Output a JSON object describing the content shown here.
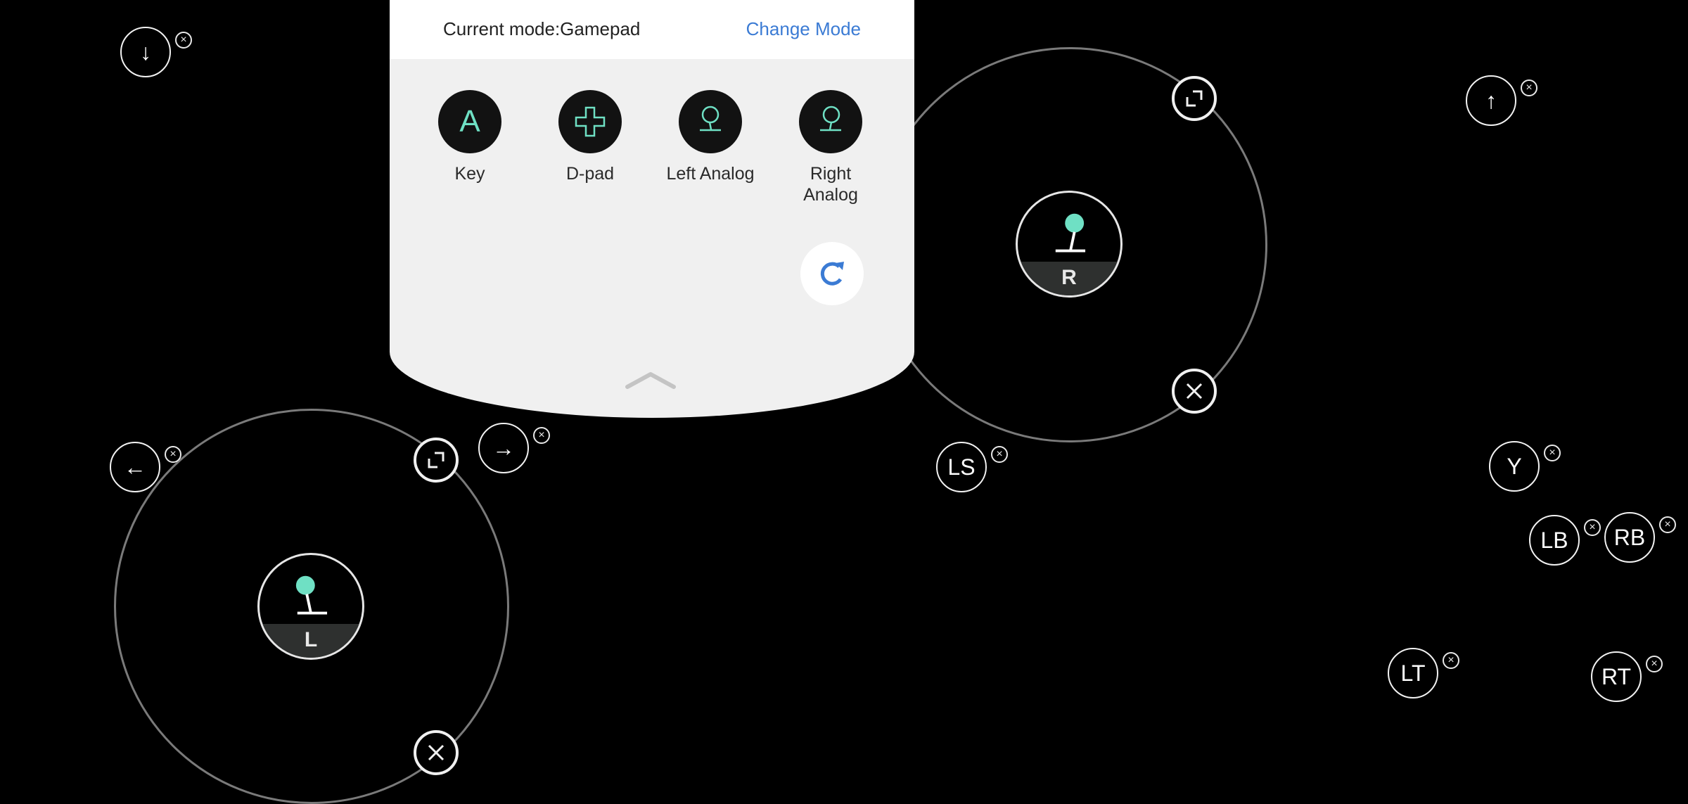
{
  "panel": {
    "current_mode_label": "Current mode:Gamepad",
    "change_mode_label": "Change Mode",
    "tools": [
      {
        "label": "Key",
        "icon": "key-a-icon",
        "glyph": "A"
      },
      {
        "label": "D-pad",
        "icon": "dpad-icon"
      },
      {
        "label": "Left Analog",
        "icon": "left-analog-icon"
      },
      {
        "label": "Right Analog",
        "icon": "right-analog-icon"
      }
    ],
    "reset_icon": "refresh-icon",
    "collapse_icon": "chevron-up-icon"
  },
  "analogs": {
    "left": {
      "label": "L"
    },
    "right": {
      "label": "R"
    }
  },
  "keys": [
    {
      "id": "down-arrow",
      "glyph": "↓"
    },
    {
      "id": "up-arrow",
      "glyph": "↑"
    },
    {
      "id": "left-arrow",
      "glyph": "←"
    },
    {
      "id": "right-arrow",
      "glyph": "→"
    },
    {
      "id": "ls",
      "glyph": "LS"
    },
    {
      "id": "y",
      "glyph": "Y"
    },
    {
      "id": "lb",
      "glyph": "LB"
    },
    {
      "id": "rb",
      "glyph": "RB"
    },
    {
      "id": "lt",
      "glyph": "LT"
    },
    {
      "id": "rt",
      "glyph": "RT"
    }
  ],
  "remove_glyph": "×",
  "colors": {
    "accent_teal": "#6fe0c4",
    "link_blue": "#3b7bd4",
    "panel_bg": "#f0f0f0"
  }
}
